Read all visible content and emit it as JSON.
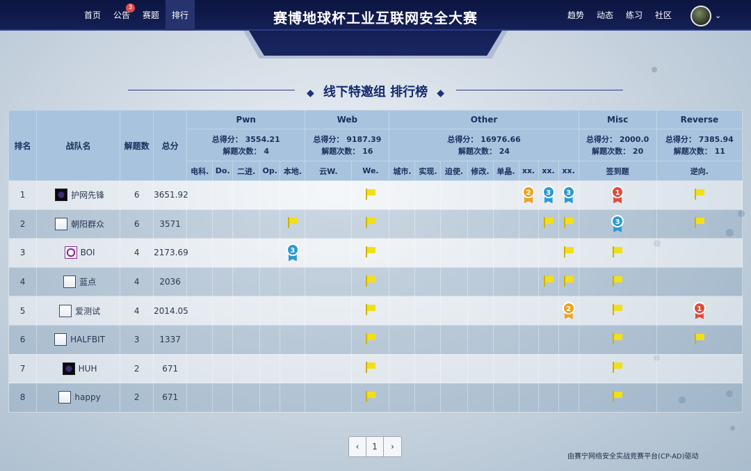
{
  "header": {
    "nav_left": [
      {
        "label": "首页"
      },
      {
        "label": "公告",
        "badge": "3"
      },
      {
        "label": "赛题"
      },
      {
        "label": "排行",
        "active": true
      }
    ],
    "title": "赛博地球杯工业互联网安全大赛",
    "nav_right": [
      {
        "label": "趋势"
      },
      {
        "label": "动态"
      },
      {
        "label": "练习"
      },
      {
        "label": "社区"
      }
    ],
    "user_menu_icon": "chevron-down-icon"
  },
  "board_title": "线下特邀组 排行榜",
  "table": {
    "headers": {
      "rank": "排名",
      "team": "战队名",
      "solved": "解题数",
      "score": "总分"
    },
    "categories": [
      {
        "name": "Pwn",
        "score_text": "总得分： 3554.21",
        "solves_text": "解题次数： 4",
        "challenges": [
          "电科.",
          "Do.",
          "二进.",
          "Op.",
          "本地."
        ]
      },
      {
        "name": "Web",
        "score_text": "总得分： 9187.39",
        "solves_text": "解题次数： 16",
        "challenges": [
          "云W.",
          "We."
        ]
      },
      {
        "name": "Other",
        "score_text": "总得分： 16976.66",
        "solves_text": "解题次数： 24",
        "challenges": [
          "城市.",
          "实现.",
          "迫使.",
          "修改.",
          "单晶.",
          "xx.",
          "xx.",
          "xx."
        ]
      },
      {
        "name": "Misc",
        "score_text": "总得分： 2000.0",
        "solves_text": "解题次数： 20",
        "challenges": [
          "签到题"
        ]
      },
      {
        "name": "Reverse",
        "score_text": "总得分： 7385.94",
        "solves_text": "解题次数： 11",
        "challenges": [
          "逆向."
        ]
      }
    ],
    "rows": [
      {
        "rank": "1",
        "team": "护网先锋",
        "icon": "red",
        "solved": "6",
        "score": "3651.92",
        "cells": [
          "",
          "",
          "",
          "",
          "",
          "",
          "F",
          "",
          "",
          "",
          "",
          "",
          "M2",
          "M3",
          "M3",
          "M1",
          "F"
        ]
      },
      {
        "rank": "2",
        "team": "朝阳群众",
        "icon": "doc",
        "solved": "6",
        "score": "3571",
        "cells": [
          "",
          "",
          "",
          "",
          "F",
          "",
          "F",
          "",
          "",
          "",
          "",
          "",
          "",
          "F",
          "F",
          "M3",
          "F"
        ]
      },
      {
        "rank": "3",
        "team": "BOI",
        "icon": "purple",
        "solved": "4",
        "score": "2173.69",
        "cells": [
          "",
          "",
          "",
          "",
          "M3",
          "",
          "F",
          "",
          "",
          "",
          "",
          "",
          "",
          "",
          "F",
          "F",
          ""
        ]
      },
      {
        "rank": "4",
        "team": "蓝点",
        "icon": "doc",
        "solved": "4",
        "score": "2036",
        "cells": [
          "",
          "",
          "",
          "",
          "",
          "",
          "F",
          "",
          "",
          "",
          "",
          "",
          "",
          "F",
          "F",
          "F",
          ""
        ]
      },
      {
        "rank": "5",
        "team": "爱测试",
        "icon": "doc",
        "solved": "4",
        "score": "2014.05",
        "cells": [
          "",
          "",
          "",
          "",
          "",
          "",
          "F",
          "",
          "",
          "",
          "",
          "",
          "",
          "",
          "M2",
          "F",
          "M1"
        ]
      },
      {
        "rank": "6",
        "team": "HALFBIT",
        "icon": "doc",
        "solved": "3",
        "score": "1337",
        "cells": [
          "",
          "",
          "",
          "",
          "",
          "",
          "F",
          "",
          "",
          "",
          "",
          "",
          "",
          "",
          "",
          "F",
          "F"
        ]
      },
      {
        "rank": "7",
        "team": "HUH",
        "icon": "red",
        "solved": "2",
        "score": "671",
        "cells": [
          "",
          "",
          "",
          "",
          "",
          "",
          "F",
          "",
          "",
          "",
          "",
          "",
          "",
          "",
          "",
          "F",
          ""
        ]
      },
      {
        "rank": "8",
        "team": "happy",
        "icon": "doc",
        "solved": "2",
        "score": "671",
        "cells": [
          "",
          "",
          "",
          "",
          "",
          "",
          "F",
          "",
          "",
          "",
          "",
          "",
          "",
          "",
          "",
          "F",
          ""
        ]
      }
    ]
  },
  "pagination": {
    "prev": "‹",
    "current": "1",
    "next": "›"
  },
  "footer": "由赛宁网络安全实战竞赛平台(CP-AD)驱动"
}
